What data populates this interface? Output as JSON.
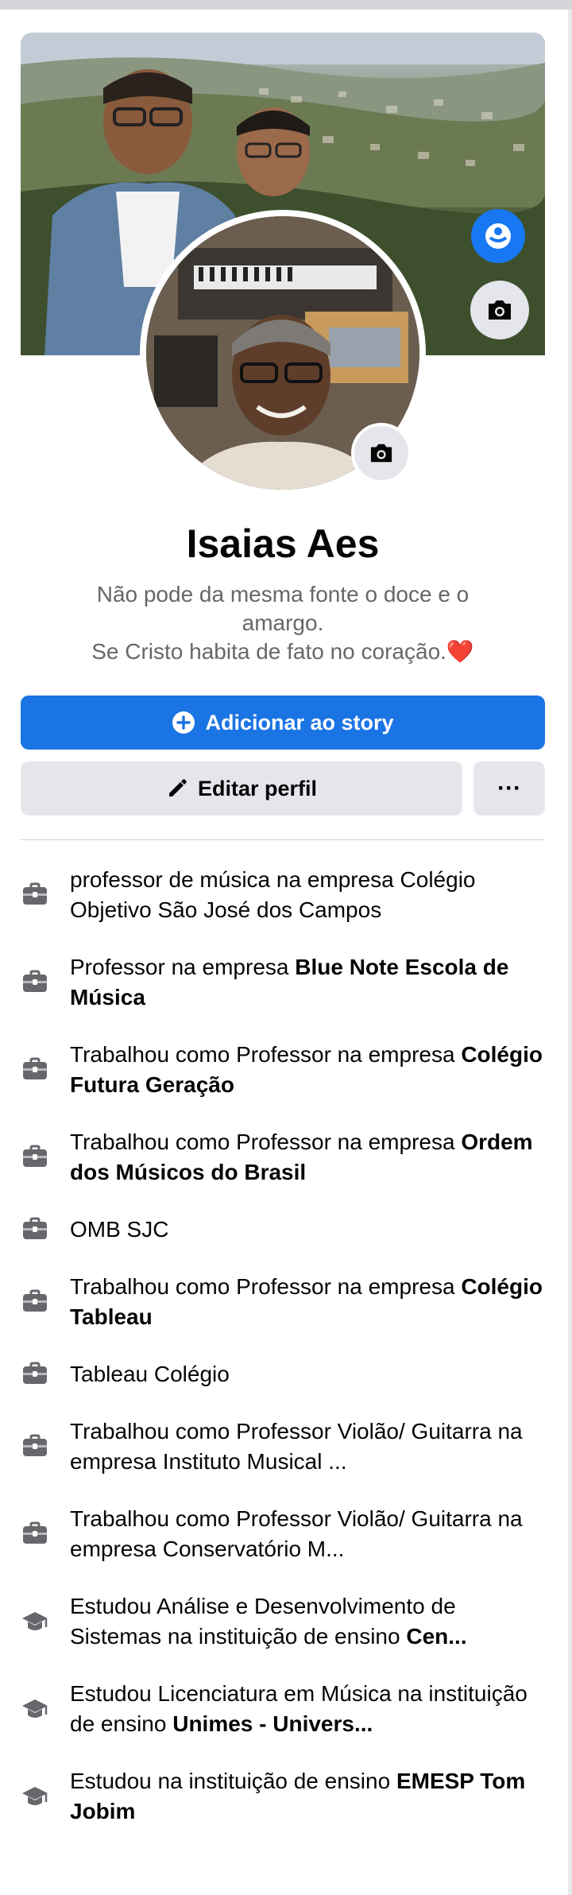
{
  "profile": {
    "name": "Isaias Aes",
    "bio_line1": "Não pode da mesma fonte o doce e o amargo.",
    "bio_line2": "Se Cristo habita de fato no coração.",
    "bio_emoji": "❤️"
  },
  "actions": {
    "add_story_label": "Adicionar ao story",
    "edit_profile_label": "Editar perfil",
    "more_label": "···"
  },
  "info": [
    {
      "icon": "briefcase-icon",
      "text": "professor de música na empresa Colégio Objetivo São José dos Campos",
      "bold": ""
    },
    {
      "icon": "briefcase-icon",
      "text": "Professor na empresa ",
      "bold": "Blue Note Escola de Música"
    },
    {
      "icon": "briefcase-icon",
      "text": "Trabalhou como Professor na empresa ",
      "bold": "Colégio Futura Geração"
    },
    {
      "icon": "briefcase-icon",
      "text": "Trabalhou como Professor na empresa ",
      "bold": "Ordem dos Músicos do Brasil"
    },
    {
      "icon": "briefcase-icon",
      "text": "OMB SJC",
      "bold": ""
    },
    {
      "icon": "briefcase-icon",
      "text": "Trabalhou como Professor na empresa ",
      "bold": "Colégio Tableau"
    },
    {
      "icon": "briefcase-icon",
      "text": "Tableau Colégio",
      "bold": ""
    },
    {
      "icon": "briefcase-icon",
      "text": "Trabalhou como Professor Violão/ Guitarra na empresa Instituto Musical ...",
      "bold": ""
    },
    {
      "icon": "briefcase-icon",
      "text": "Trabalhou como Professor Violão/ Guitarra na empresa Conservatório M...",
      "bold": ""
    },
    {
      "icon": "graduation-cap-icon",
      "text": "Estudou Análise e Desenvolvimento de Sistemas na instituição de ensino ",
      "bold": "Cen..."
    },
    {
      "icon": "graduation-cap-icon",
      "text": "Estudou Licenciatura em Música na instituição de ensino ",
      "bold": "Unimes - Univers..."
    },
    {
      "icon": "graduation-cap-icon",
      "text": "Estudou na instituição de ensino ",
      "bold": "EMESP Tom Jobim"
    }
  ],
  "colors": {
    "accent": "#1b74e4",
    "secondary_button": "#e4e6eb",
    "muted_text": "#65676b"
  }
}
